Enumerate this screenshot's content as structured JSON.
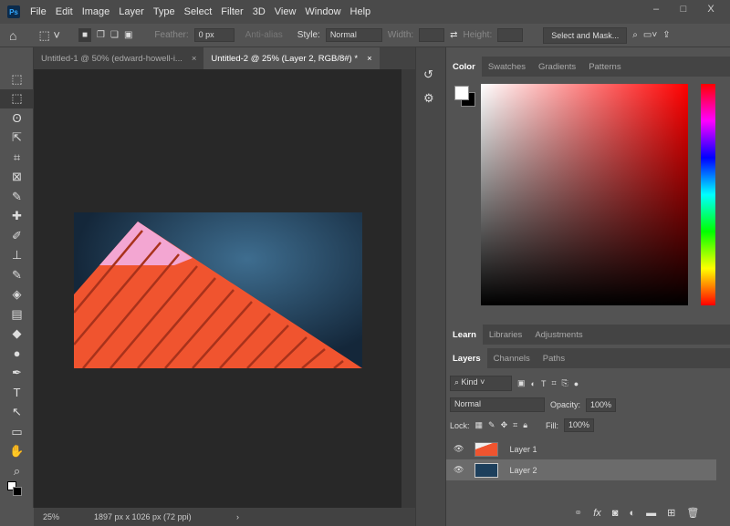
{
  "app": {
    "logo": "Ps"
  },
  "menu": [
    "File",
    "Edit",
    "Image",
    "Layer",
    "Type",
    "Select",
    "Filter",
    "3D",
    "View",
    "Window",
    "Help"
  ],
  "window_controls": {
    "minimize": "–",
    "maximize": "□",
    "close": "X"
  },
  "options": {
    "feather_label": "Feather:",
    "feather_value": "0 px",
    "anti_alias": "Anti-alias",
    "style_label": "Style:",
    "style_value": "Normal",
    "width_label": "Width:",
    "height_label": "Height:",
    "select_mask": "Select and Mask..."
  },
  "tabs": [
    {
      "label": "Untitled-1 @ 50% (edward-howell-i...",
      "close": "×"
    },
    {
      "label": "Untitled-2 @ 25% (Layer 2, RGB/8#) *",
      "close": "×"
    }
  ],
  "tools": [
    "⬚",
    "⬚",
    "ʘ",
    "⇱",
    "⌗",
    "⊠",
    "✎",
    "✚",
    "✐",
    "⊥",
    "✎",
    "◈",
    "▤",
    "◆",
    "●",
    "✒",
    "T",
    "↖",
    "▭",
    "✋",
    "⌕"
  ],
  "status": {
    "zoom": "25%",
    "info": "1897 px x 1026 px (72 ppi)",
    "arrow": "›"
  },
  "color_panel": {
    "tabs": [
      "Color",
      "Swatches",
      "Gradients",
      "Patterns"
    ],
    "foreground": "#ffffff",
    "background": "#000000",
    "hue": "#ff0000"
  },
  "learn_panel": {
    "tabs": [
      "Learn",
      "Libraries",
      "Adjustments"
    ]
  },
  "layers_panel": {
    "tabs": [
      "Layers",
      "Channels",
      "Paths"
    ],
    "filter": "Kind",
    "blend_mode": "Normal",
    "opacity_label": "Opacity:",
    "opacity": "100%",
    "lock_label": "Lock:",
    "fill_label": "Fill:",
    "fill": "100%",
    "layers": [
      {
        "name": "Layer 1",
        "selected": false
      },
      {
        "name": "Layer 2",
        "selected": true
      }
    ]
  }
}
